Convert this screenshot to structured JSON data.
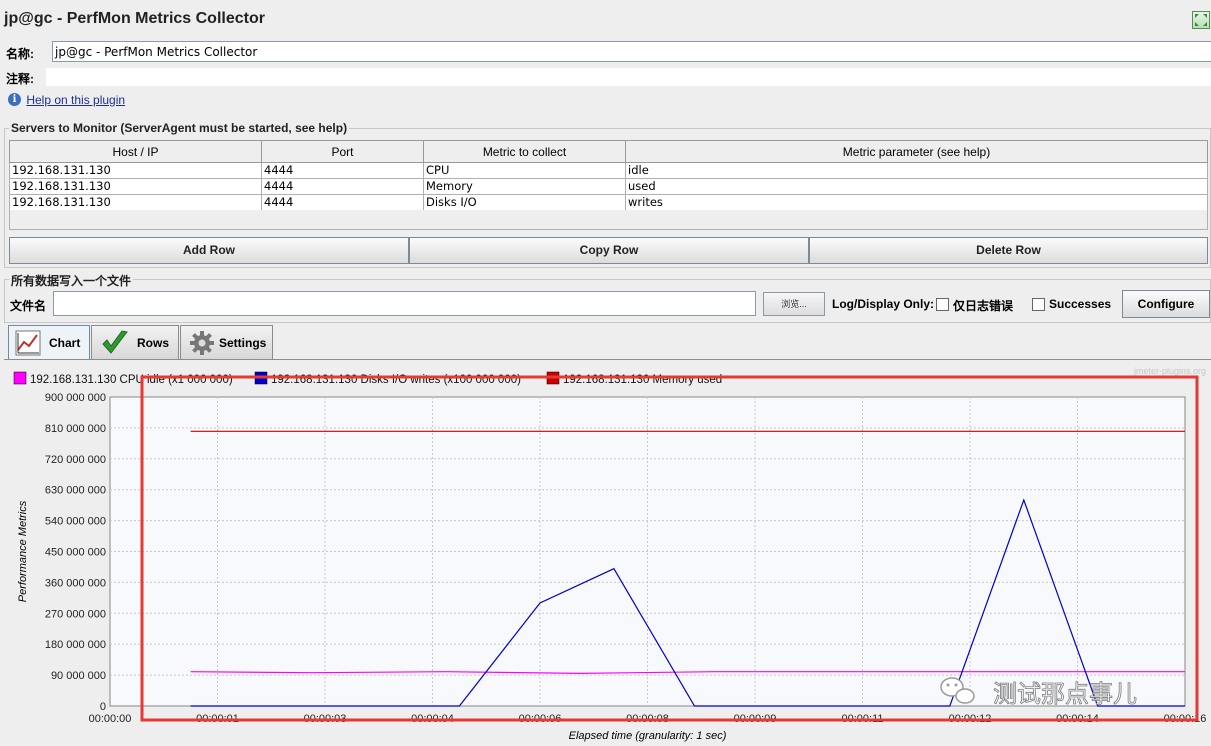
{
  "window": {
    "title": "jp@gc - PerfMon Metrics Collector"
  },
  "form": {
    "name_label": "名称:",
    "name_value": "jp@gc - PerfMon Metrics Collector",
    "comment_label": "注释:",
    "help_link": "Help on this plugin"
  },
  "servers": {
    "group_title": "Servers to Monitor (ServerAgent must be started, see help)",
    "columns": [
      "Host / IP",
      "Port",
      "Metric to collect",
      "Metric parameter (see help)"
    ],
    "rows": [
      [
        "192.168.131.130",
        "4444",
        "CPU",
        "idle"
      ],
      [
        "192.168.131.130",
        "4444",
        "Memory",
        "used"
      ],
      [
        "192.168.131.130",
        "4444",
        "Disks I/O",
        "writes"
      ]
    ],
    "buttons": {
      "add": "Add Row",
      "copy": "Copy Row",
      "delete": "Delete Row"
    }
  },
  "file": {
    "group_title": "所有数据写入一个文件",
    "label": "文件名",
    "value": "",
    "browse": "浏览...",
    "log_display_label": "Log/Display Only:",
    "errors_only": "仅日志错误",
    "successes": "Successes",
    "configure": "Configure"
  },
  "tabs": [
    {
      "label": "Chart",
      "icon": "chart-icon",
      "active": true
    },
    {
      "label": "Rows",
      "icon": "checkmark-icon",
      "active": false
    },
    {
      "label": "Settings",
      "icon": "gear-icon",
      "active": false
    }
  ],
  "watermark": "jmeter-plugins.org",
  "overlay_caption": "测试那点事儿",
  "colors": {
    "cpu": "#ff00ff",
    "disks": "#0000cc",
    "memory": "#cc0000",
    "highlight_box": "#e53935"
  },
  "chart_data": {
    "type": "line",
    "ylabel": "Performance Metrics",
    "xlabel": "Elapsed time (granularity: 1 sec)",
    "yticks": [
      "900 000 000",
      "810 000 000",
      "720 000 000",
      "630 000 000",
      "540 000 000",
      "450 000 000",
      "360 000 000",
      "270 000 000",
      "180 000 000",
      "90 000 000",
      "0"
    ],
    "ylim": [
      0,
      900000000
    ],
    "xticks": [
      "00:00:00",
      "00:00:01",
      "00:00:03",
      "00:00:04",
      "00:00:06",
      "00:00:08",
      "00:00:09",
      "00:00:11",
      "00:00:12",
      "00:00:14",
      "00:00:16"
    ],
    "xlim": [
      0,
      16
    ],
    "grid": true,
    "legend_position": "top-left",
    "series": [
      {
        "name": "192.168.131.130 CPU idle (x1 000 000)",
        "color": "#ff00ff",
        "x": [
          1.2,
          3,
          5,
          7,
          9,
          11,
          13,
          15,
          16
        ],
        "y": [
          100000000,
          97000000,
          100000000,
          95000000,
          100000000,
          100000000,
          100000000,
          100000000,
          100000000
        ]
      },
      {
        "name": "192.168.131.130 Disks I/O writes (x100 000 000)",
        "color": "#0000cc",
        "x": [
          1.2,
          5.2,
          6.4,
          7.5,
          8.7,
          12.5,
          13.6,
          14.7,
          16
        ],
        "y": [
          0,
          0,
          300000000,
          400000000,
          0,
          0,
          600000000,
          0,
          0
        ]
      },
      {
        "name": "192.168.131.130 Memory used",
        "color": "#cc0000",
        "x": [
          1.2,
          16
        ],
        "y": [
          800000000,
          800000000
        ]
      }
    ]
  }
}
